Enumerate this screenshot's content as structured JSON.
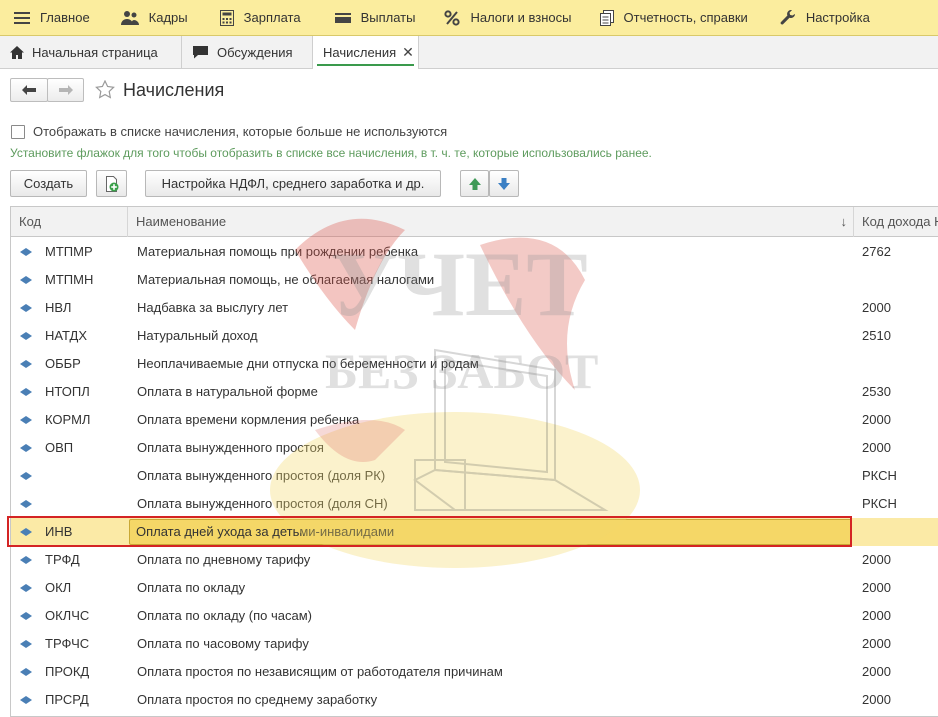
{
  "sections": [
    {
      "label": "Главное",
      "icon": "menu-icon"
    },
    {
      "label": "Кадры",
      "icon": "people-icon"
    },
    {
      "label": "Зарплата",
      "icon": "calculator-icon"
    },
    {
      "label": "Выплаты",
      "icon": "wallet-icon"
    },
    {
      "label": "Налоги и взносы",
      "icon": "percent-icon"
    },
    {
      "label": "Отчетность, справки",
      "icon": "documents-icon"
    },
    {
      "label": "Настройка",
      "icon": "wrench-icon"
    }
  ],
  "tabs": [
    {
      "label": "Начальная страница",
      "icon": "home-icon",
      "active": false
    },
    {
      "label": "Обсуждения",
      "icon": "chat-icon",
      "active": false
    },
    {
      "label": "Начисления",
      "active": true,
      "close": "✕"
    }
  ],
  "page": {
    "title": "Начисления",
    "checkbox_label": "Отображать в списке начисления, которые больше не используются",
    "checkbox_checked": false,
    "hint": "Установите флажок для того чтобы отобразить в списке все начисления, в т. ч. те, которые использовались ранее."
  },
  "toolbar": {
    "create_label": "Создать",
    "ndfl_settings_label": "Настройка НДФЛ, среднего заработка и др."
  },
  "table": {
    "columns": [
      "Код",
      "Наименование",
      "Код дохода Н"
    ],
    "sort_indicator": "↓",
    "rows": [
      {
        "code": "МТПМР",
        "name": "Материальная помощь при рождении ребенка",
        "income_code": "2762"
      },
      {
        "code": "МТПМН",
        "name": "Материальная помощь, не облагаемая налогами",
        "income_code": ""
      },
      {
        "code": "НВЛ",
        "name": "Надбавка за выслугу лет",
        "income_code": "2000"
      },
      {
        "code": "НАТДХ",
        "name": "Натуральный доход",
        "income_code": "2510"
      },
      {
        "code": "ОББР",
        "name": "Неоплачиваемые дни отпуска по беременности и родам",
        "income_code": ""
      },
      {
        "code": "НТОПЛ",
        "name": "Оплата в натуральной форме",
        "income_code": "2530"
      },
      {
        "code": "КОРМЛ",
        "name": "Оплата времени кормления ребенка",
        "income_code": "2000"
      },
      {
        "code": "ОВП",
        "name": "Оплата вынужденного простоя",
        "income_code": "2000"
      },
      {
        "code": "",
        "name": "Оплата вынужденного простоя (доля РК)",
        "income_code": "РКСН"
      },
      {
        "code": "",
        "name": "Оплата вынужденного простоя (доля СН)",
        "income_code": "РКСН"
      },
      {
        "code": "ИНВ",
        "name": "Оплата дней ухода за детьми-инвалидами",
        "income_code": "",
        "selected": true
      },
      {
        "code": "ТРФД",
        "name": "Оплата по дневному тарифу",
        "income_code": "2000"
      },
      {
        "code": "ОКЛ",
        "name": "Оплата по окладу",
        "income_code": "2000"
      },
      {
        "code": "ОКЛЧС",
        "name": "Оплата по окладу (по часам)",
        "income_code": "2000"
      },
      {
        "code": "ТРФЧС",
        "name": "Оплата по часовому тарифу",
        "income_code": "2000"
      },
      {
        "code": "ПРОКД",
        "name": "Оплата простоя по независящим от работодателя причинам",
        "income_code": "2000"
      },
      {
        "code": "ПРСРД",
        "name": "Оплата простоя по среднему заработку",
        "income_code": "2000"
      }
    ]
  },
  "watermark": {
    "line1": "УЧЕТ",
    "line2": "БЕЗ ЗАБОТ"
  },
  "colors": {
    "section_bar": "#fbed9e",
    "hint_text": "#5d9b5d",
    "selected_row": "#fbeaa6",
    "highlight_frame": "#d42424",
    "row_marker": "#4a7fb5"
  }
}
